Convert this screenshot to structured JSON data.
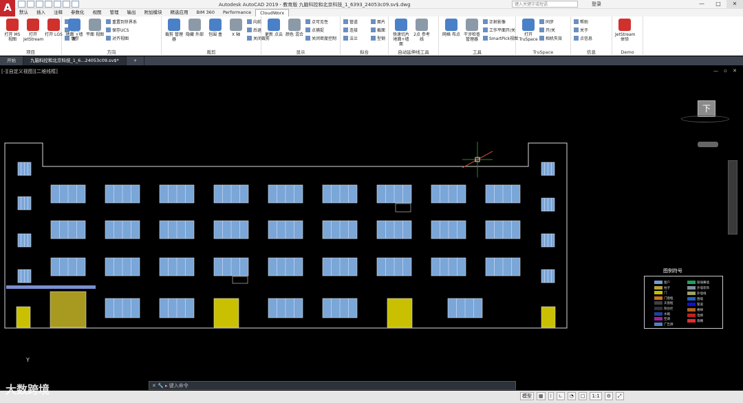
{
  "title_bar": {
    "app_title": "Autodesk AutoCAD 2019 - 教育版    九脑科控和北京科技_1_6393_24053c09.sv$.dwg",
    "search_placeholder": "键入关键字或短语",
    "user_label": "登录",
    "min": "—",
    "max": "□",
    "close": "✕"
  },
  "ribbon_tabs": [
    "默认",
    "插入",
    "注释",
    "参数化",
    "视图",
    "管理",
    "输出",
    "附加模块",
    "精选应用",
    "BIM 360",
    "Performance",
    "CloudWorx"
  ],
  "active_tab": "CloudWorx",
  "panels": [
    {
      "label": "项目",
      "buttons": [
        "打开 MS视图",
        "打开 JetStream",
        "打开 LGS"
      ],
      "small": [
        "打开",
        "关闭",
        "保存"
      ]
    },
    {
      "label": "方向",
      "buttons": [
        "地面 +墙面",
        "平面 视图"
      ],
      "small": [
        "重置到世界系",
        "保存UCS",
        "对齐视图"
      ]
    },
    {
      "label": "裁剪",
      "buttons": [
        "裁剪 管理器",
        "隐藏 外部",
        "包围 盒",
        "X 轴"
      ],
      "small": [
        "向前",
        "后退",
        "关闭裁剪"
      ]
    },
    {
      "label": "显示",
      "buttons": [
        "更新 点云",
        "颜色 混合"
      ],
      "small": [
        "点可见性",
        "点捕捉",
        "关闭密度控制"
      ]
    },
    {
      "label": "拟合",
      "small": [
        "管道",
        "连接",
        "法兰",
        "面片",
        "截面",
        "型钢"
      ]
    },
    {
      "label": "自动延伸线工具",
      "buttons": [
        "快速切片 地面+墙面",
        "2点 参考线"
      ]
    },
    {
      "label": "工具",
      "buttons": [
        "网格 布点",
        "干涉检查 管理器"
      ],
      "small": [
        "正射影像",
        "工作平面开/关",
        "SmartPick视图"
      ]
    },
    {
      "label": "TruSpace",
      "buttons": [
        "打开 TruSpace"
      ],
      "small": [
        "同步",
        "开/关",
        "相机失效"
      ]
    },
    {
      "label": "信息",
      "small": [
        "帮助",
        "关于",
        "点信息"
      ]
    },
    {
      "label": "Demo",
      "buttons": [
        "JetStream 体验"
      ]
    }
  ],
  "doc_tabs": [
    "开始",
    "九脑科控和北京科技_1_6...24053c09.sv$*",
    "+"
  ],
  "viewport": {
    "label": "[-][自定义视图][二维线框]",
    "controls": "— ▫ ✕"
  },
  "viewcube": {
    "face": "下"
  },
  "legend": {
    "title": "图例符号",
    "items_left": [
      {
        "label": "窗户",
        "color": "#6f9bd1"
      },
      {
        "label": "柱子",
        "color": "#b5a038"
      },
      {
        "label": "门",
        "color": "#c0c000"
      },
      {
        "label": "门窗框",
        "color": "#d07020"
      },
      {
        "label": "天窗框",
        "color": "#404040"
      },
      {
        "label": "阳台栏",
        "color": "#303030"
      },
      {
        "label": "水箱",
        "color": "#2040a0"
      },
      {
        "label": "空调",
        "color": "#a020a0"
      },
      {
        "label": "广告牌",
        "color": "#5080c0"
      }
    ],
    "items_right": [
      {
        "label": "玻璃幕墙",
        "color": "#20a060"
      },
      {
        "label": "外墙装饰",
        "color": "#8090a0"
      },
      {
        "label": "外墙线",
        "color": "#a0a060"
      },
      {
        "label": "围墙",
        "color": "#2060c0"
      },
      {
        "label": "管道",
        "color": "#1010d0"
      },
      {
        "label": "楼梯",
        "color": "#b06020"
      },
      {
        "label": "电梯",
        "color": "#c02020"
      },
      {
        "label": "雨棚",
        "color": "#e03030"
      }
    ]
  },
  "command_line": {
    "prompt": "键入命令"
  },
  "status": {
    "model": "模型",
    "scale": "1:1"
  },
  "watermark": "大数跨境",
  "ucs": "Y",
  "colors": {
    "ribbon_accent": "#d0312d",
    "canvas": "#000000",
    "window_fill": "#7aa6d8",
    "hatch_fill": "#c8c000"
  }
}
